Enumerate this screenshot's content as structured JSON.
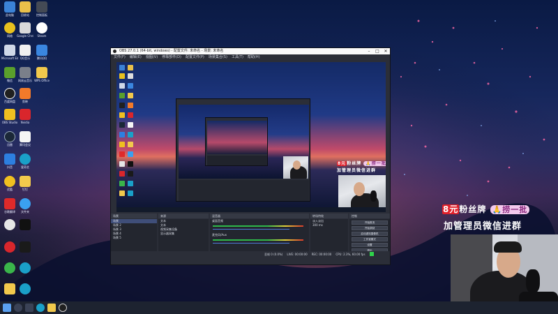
{
  "obs_window": {
    "title": "OBS 27.0.1 (64-bit, windows) - 配置文件: 未命名 - 场景: 未命名",
    "menu": [
      "文件(F)",
      "编辑(E)",
      "视图(V)",
      "停靠部件(D)",
      "配置文件(P)",
      "场景集合(S)",
      "工具(T)",
      "帮助(H)"
    ],
    "window_controls": {
      "minimize": "–",
      "maximize": "□",
      "close": "✕"
    },
    "docks": {
      "scenes_header": "场景",
      "sources_header": "来源",
      "mixer_header": "混音器",
      "transitions_header": "转场特效",
      "controls_header": "控制",
      "scenes": [
        "场景",
        "场景 2",
        "场景 3",
        "场景 4",
        "场景 5"
      ],
      "sources": [
        "文本",
        "文本",
        "视频采集设备",
        "显示器采集"
      ],
      "mixer_channels": [
        {
          "name": "桌面音频",
          "db": "0.0 dB"
        },
        {
          "name": "麦克风/Aux",
          "db": "0.0 dB"
        }
      ],
      "transition": {
        "type": "淡入淡出",
        "duration_label": "时长",
        "duration": "300 ms"
      },
      "controls": [
        "开始推流",
        "开始录制",
        "启动虚拟摄像机",
        "工作室模式",
        "设置",
        "退出"
      ],
      "status": [
        "丢帧 0 (0.0%)",
        "LIVE: 00:00:00",
        "REC: 00:00:00",
        "CPU: 2.3%, 60.00 fps"
      ]
    }
  },
  "overlay": {
    "line1_tag": "8元",
    "line1_text": "粉丝牌",
    "line1_pill": "🙏捞一批",
    "line2_text": "加管理员微信进群"
  },
  "desktop": {
    "icon_labels": [
      "此电脑",
      "回收站",
      "控制面板",
      "网络",
      "Google Chrome",
      "Steam",
      "Microsoft Edge",
      "QQ音乐",
      "腾讯QQ",
      "微信",
      "网易云音乐",
      "WPS Office",
      "百度网盘",
      "剪映",
      "OBS Studio",
      "Nvidia",
      "迅雷",
      "腾讯会议",
      "抖音",
      "爱奇艺",
      "优酷",
      "钉钉",
      "谷歌翻译",
      "文件夹"
    ]
  },
  "colors": {
    "obs_panel": "#2b2e38",
    "obs_dock": "#23262f",
    "accent_blue": "#3f4e79",
    "meter_green": "#2fb84a",
    "status_red": "#e0202a",
    "status_green": "#2fd34a"
  }
}
